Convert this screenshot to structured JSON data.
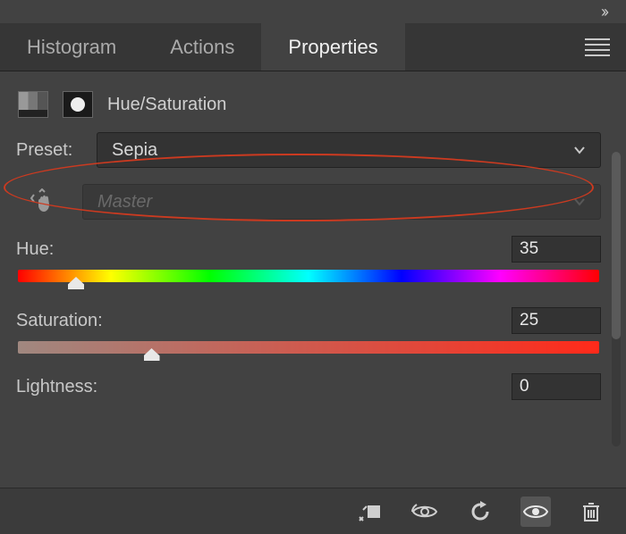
{
  "tabs": {
    "histogram": "Histogram",
    "actions": "Actions",
    "properties": "Properties"
  },
  "header": {
    "title": "Hue/Saturation"
  },
  "preset": {
    "label": "Preset:",
    "value": "Sepia"
  },
  "channel": {
    "value": "Master"
  },
  "hue": {
    "label": "Hue:",
    "value": "35",
    "thumb_percent": 10
  },
  "saturation": {
    "label": "Saturation:",
    "value": "25",
    "thumb_percent": 23
  },
  "lightness": {
    "label": "Lightness:",
    "value": "0"
  }
}
